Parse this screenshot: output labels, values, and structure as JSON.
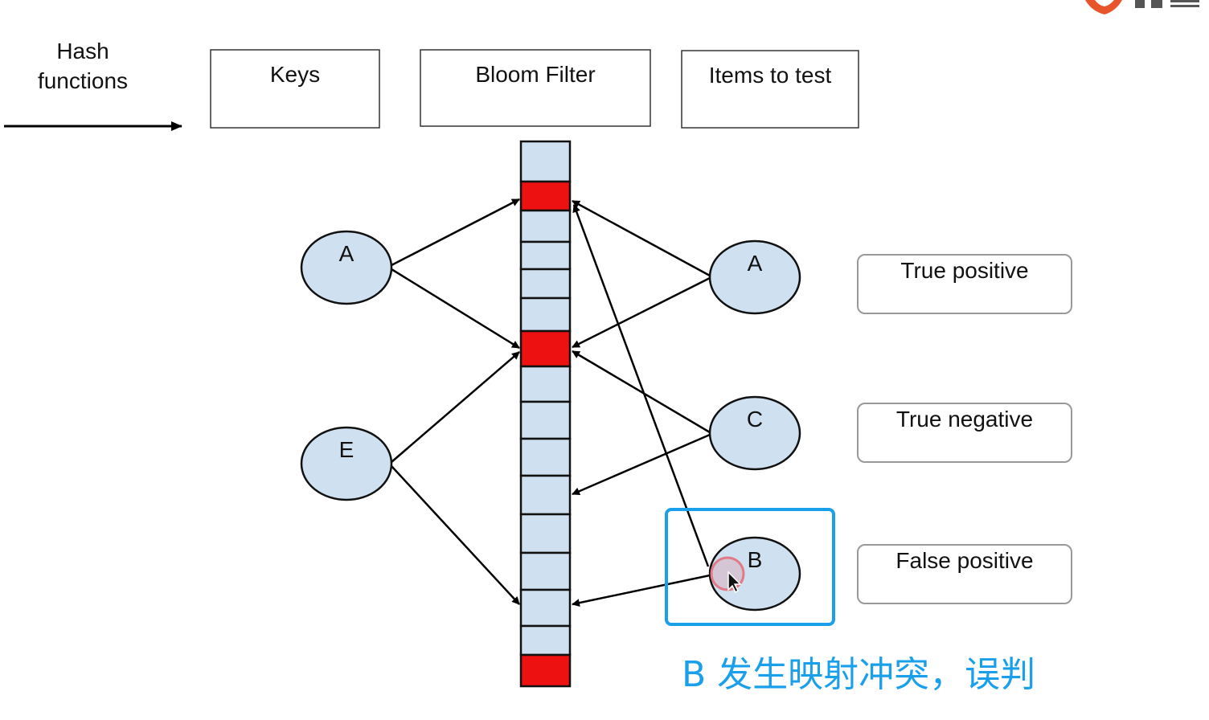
{
  "header": {
    "hash_line1": "Hash",
    "hash_line2": "functions",
    "keys": "Keys",
    "bloom_filter": "Bloom Filter",
    "items_to_test": "Items to test"
  },
  "keys": [
    {
      "id": "key-a",
      "label": "A"
    },
    {
      "id": "key-e",
      "label": "E"
    }
  ],
  "items": [
    {
      "id": "item-a",
      "label": "A"
    },
    {
      "id": "item-c",
      "label": "C"
    },
    {
      "id": "item-b",
      "label": "B"
    }
  ],
  "results": [
    {
      "id": "true-positive",
      "label": "True positive"
    },
    {
      "id": "true-negative",
      "label": "True negative"
    },
    {
      "id": "false-positive",
      "label": "False positive"
    }
  ],
  "bloom_filter": {
    "cells": 17,
    "set_cells": [
      1,
      6,
      15
    ]
  },
  "annotation": {
    "text": "B 发生映射冲突，误判",
    "color": "#1aa0ea"
  },
  "colors": {
    "node_fill": "#cfe0f1",
    "set_bit": "#ee1111",
    "cell_fill": "#cfe0f1",
    "highlight_box": "#1aa0ea"
  }
}
